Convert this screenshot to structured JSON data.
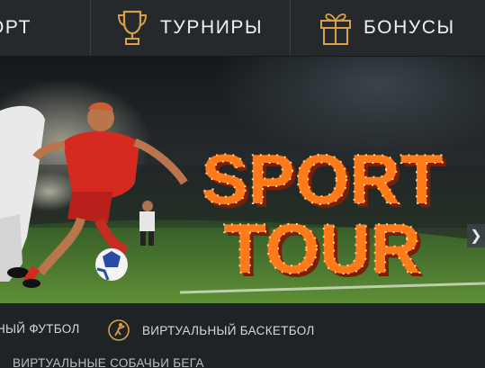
{
  "nav": {
    "items": [
      {
        "label": "ОРТ",
        "icon": "sport-icon"
      },
      {
        "label": "ТУРНИРЫ",
        "icon": "trophy-icon"
      },
      {
        "label": "БОНУСЫ",
        "icon": "gift-icon"
      }
    ]
  },
  "banner": {
    "line1": "SPORT",
    "line2": "TOUR",
    "next_icon": "chevron-right-icon"
  },
  "categories": [
    {
      "label": "НЫЙ ФУТБОЛ"
    },
    {
      "label": "ВИРТУАЛЬНЫЙ БАСКЕТБОЛ",
      "icon": "basketball-player-icon"
    },
    {
      "label": "ВИРТУАЛЬНЫЕ СОБАЧЬИ БЕГА"
    }
  ],
  "colors": {
    "accent_gold": "#d9a04a",
    "marquee_orange": "#ff7a1a",
    "nav_bg": "#25292c"
  }
}
